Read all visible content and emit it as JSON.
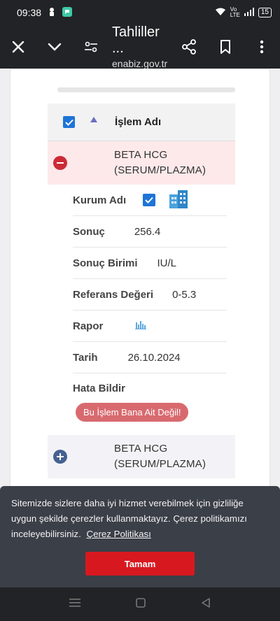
{
  "status": {
    "time": "09:38",
    "battery": "15"
  },
  "appbar": {
    "title": "Tahliller ...",
    "subtitle": "enabiz.gov.tr"
  },
  "table": {
    "header_label": "İşlem Adı"
  },
  "rows": [
    {
      "name_line1": "BETA HCG",
      "name_line2": "(SERUM/PLAZMA)",
      "details": {
        "kurum_label": "Kurum Adı",
        "sonuc_label": "Sonuç",
        "sonuc_value": "256.4",
        "birim_label": "Sonuç Birimi",
        "birim_value": "IU/L",
        "referans_label": "Referans Değeri",
        "referans_value": "0-5.3",
        "rapor_label": "Rapor",
        "tarih_label": "Tarih",
        "tarih_value": "26.10.2024",
        "hata_label": "Hata Bildir",
        "hata_button": "Bu İşlem Bana Ait Değil!"
      }
    },
    {
      "name_line1": "BETA HCG",
      "name_line2": "(SERUM/PLAZMA)"
    }
  ],
  "cookie": {
    "text": "Sitemizde sizlere daha iyi hizmet verebilmek için gizliliğe uygun şekilde çerezler kullanmaktayız. Çerez politikamızı inceleyebilirsiniz.",
    "policy_link": "Çerez Politikası",
    "ok_button": "Tamam"
  },
  "colors": {
    "accent_red": "#d7191f",
    "checkbox_blue": "#1e74d8",
    "expanded_row": "#fde9ea",
    "banner_bg": "#3b3f48"
  }
}
